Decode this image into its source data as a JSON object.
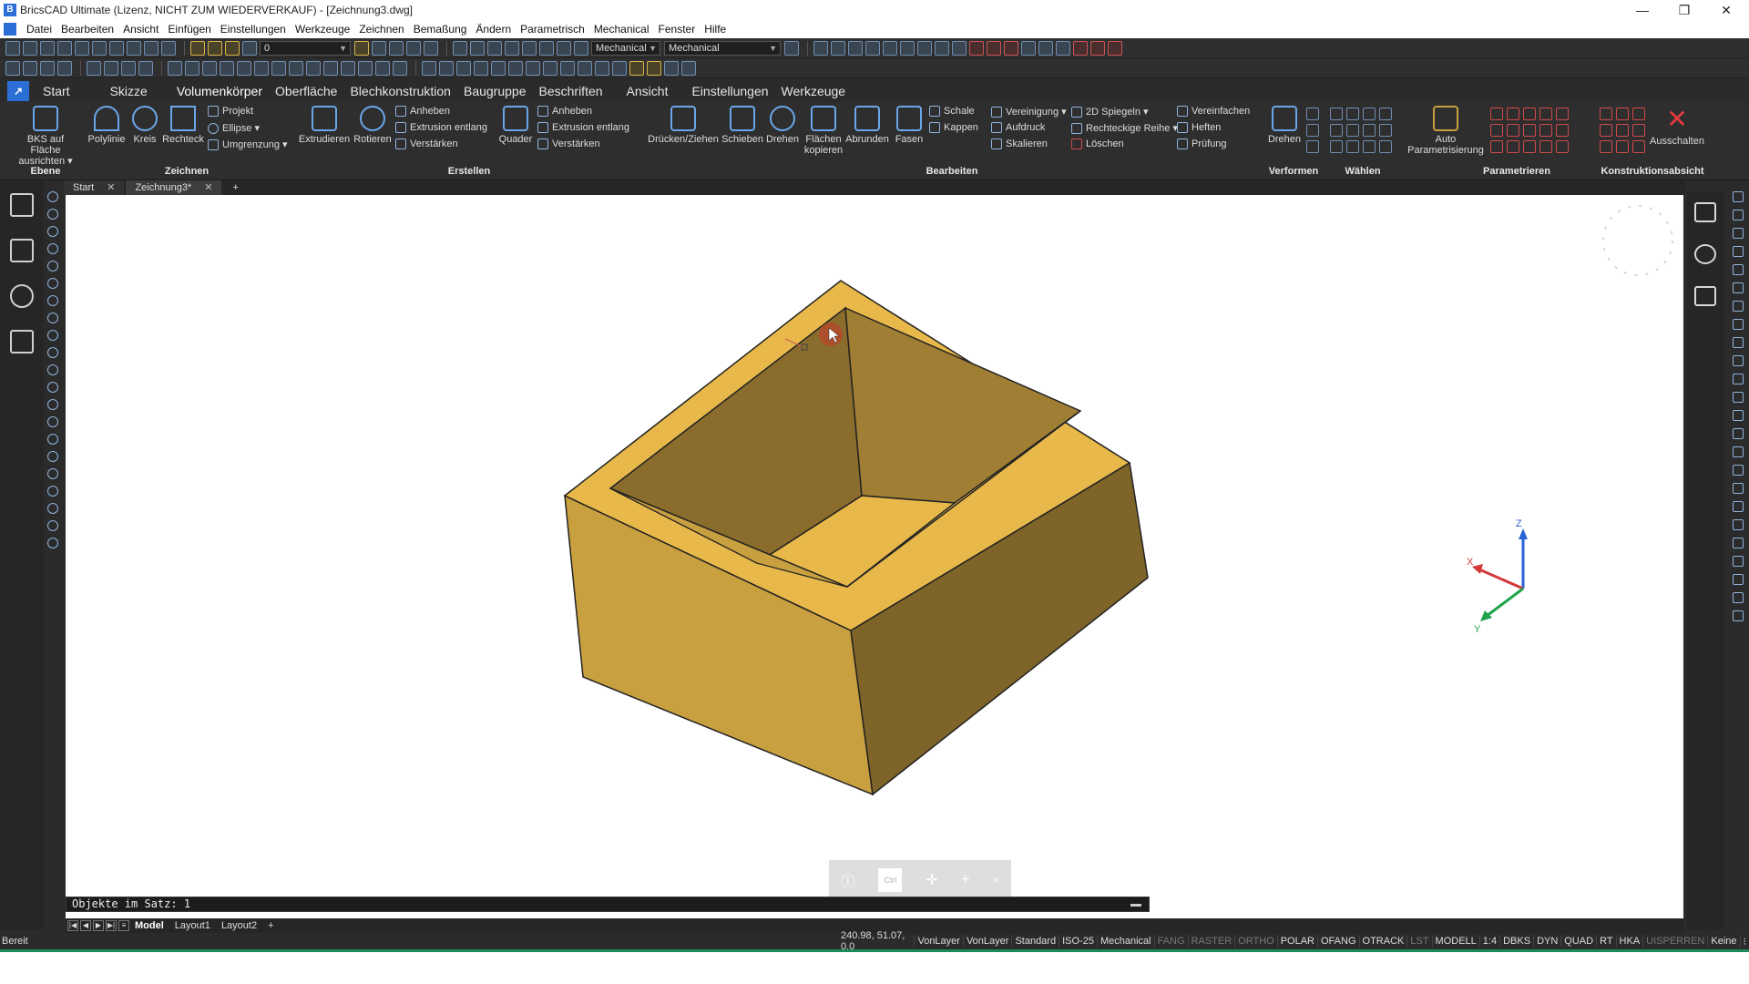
{
  "window": {
    "title": "BricsCAD Ultimate (Lizenz, NICHT ZUM WIEDERVERKAUF) - [Zeichnung3.dwg]",
    "minimize": "—",
    "restore": "❐",
    "close": "✕"
  },
  "menu": [
    "Datei",
    "Bearbeiten",
    "Ansicht",
    "Einfügen",
    "Einstellungen",
    "Werkzeuge",
    "Zeichnen",
    "Bemaßung",
    "Ändern",
    "Parametrisch",
    "Mechanical",
    "Fenster",
    "Hilfe"
  ],
  "toolbar1": {
    "layer_value": "0",
    "workspace_value": "Mechanical",
    "style_value": "Mechanical"
  },
  "ribbon_tabs": [
    "Start",
    "Skizze",
    "Volumenkörper",
    "Oberfläche",
    "Blechkonstruktion",
    "Baugruppe",
    "Beschriften",
    "Ansicht",
    "Einstellungen",
    "Werkzeuge"
  ],
  "ribbon": {
    "ebene": {
      "bks_line1": "BKS auf Fläche",
      "bks_line2": "ausrichten ▾",
      "group": "Ebene"
    },
    "zeichnen": {
      "polylinie": "Polylinie",
      "kreis": "Kreis",
      "rechteck": "Rechteck",
      "projekt": "Projekt",
      "ellipse": "Ellipse ▾",
      "umgrenzung": "Umgrenzung ▾",
      "group": "Zeichnen"
    },
    "erstellen": {
      "extrudieren": "Extrudieren",
      "rotieren": "Rotieren",
      "anheben1": "Anheben",
      "extrusion1": "Extrusion entlang",
      "verstaerken1": "Verstärken",
      "quader": "Quader",
      "anheben2": "Anheben",
      "extrusion2": "Extrusion entlang",
      "verstaerken2": "Verstärken",
      "group": "Erstellen"
    },
    "bearbeiten": {
      "druecken": "Drücken/Ziehen",
      "schieben": "Schieben",
      "drehen": "Drehen",
      "flaechen1": "Flächen",
      "flaechen2": "kopieren",
      "abrunden": "Abrunden",
      "fasen": "Fasen",
      "schale": "Schale",
      "kappen": "Kappen",
      "vereinigung": "Vereinigung ▾",
      "aufdruck": "Aufdruck",
      "skalieren": "Skalieren",
      "spiegeln": "2D Spiegeln ▾",
      "reihe": "Rechteckige Reihe ▾",
      "loeschen": "Löschen",
      "vereinfachen": "Vereinfachen",
      "heften": "Heften",
      "pruefung": "Prüfung",
      "group": "Bearbeiten"
    },
    "verformen": {
      "drehen": "Drehen",
      "group": "Verformen"
    },
    "waehlen": {
      "group": "Wählen"
    },
    "parametrieren": {
      "auto1": "Auto",
      "auto2": "Parametrisierung",
      "group": "Parametrieren"
    },
    "konstruktion": {
      "ausschalten": "Ausschalten",
      "group": "Konstruktionsabsicht"
    }
  },
  "doc_tabs": {
    "start": "Start",
    "drawing": "Zeichnung3*",
    "add": "+"
  },
  "command_line": "Objekte im Satz: 1",
  "layout_tabs": {
    "model": "Model",
    "layout1": "Layout1",
    "layout2": "Layout2",
    "add": "+"
  },
  "status": {
    "ready": "Bereit",
    "coords": "240.98, 51.07, 0.0",
    "items": [
      {
        "label": "VonLayer",
        "on": true
      },
      {
        "label": "VonLayer",
        "on": true
      },
      {
        "label": "Standard",
        "on": true
      },
      {
        "label": "ISO-25",
        "on": true
      },
      {
        "label": "Mechanical",
        "on": true
      },
      {
        "label": "FANG",
        "on": false
      },
      {
        "label": "RASTER",
        "on": false
      },
      {
        "label": "ORTHO",
        "on": false
      },
      {
        "label": "POLAR",
        "on": true
      },
      {
        "label": "OFANG",
        "on": true
      },
      {
        "label": "OTRACK",
        "on": true
      },
      {
        "label": "LST",
        "on": false
      },
      {
        "label": "MODELL",
        "on": true
      },
      {
        "label": "1:4",
        "on": true
      },
      {
        "label": "DBKS",
        "on": true
      },
      {
        "label": "DYN",
        "on": true
      },
      {
        "label": "QUAD",
        "on": true
      },
      {
        "label": "RT",
        "on": true
      },
      {
        "label": "HKA",
        "on": true
      },
      {
        "label": "UISPERREN",
        "on": false
      },
      {
        "label": "Keine",
        "on": true
      }
    ]
  },
  "quad": {
    "ctrl": "Ctrl",
    "close": "×"
  },
  "ucs": {
    "z": "Z",
    "x": "X",
    "y": "Y"
  },
  "colors": {
    "solid_face_top": "#e8b94a",
    "solid_face_left": "#c9a040",
    "solid_face_right": "#7e6428",
    "solid_inner_dark": "#8a6c2c",
    "axis_x": "#d23a3a",
    "axis_y": "#1fa34a",
    "axis_z": "#2a62d6"
  }
}
